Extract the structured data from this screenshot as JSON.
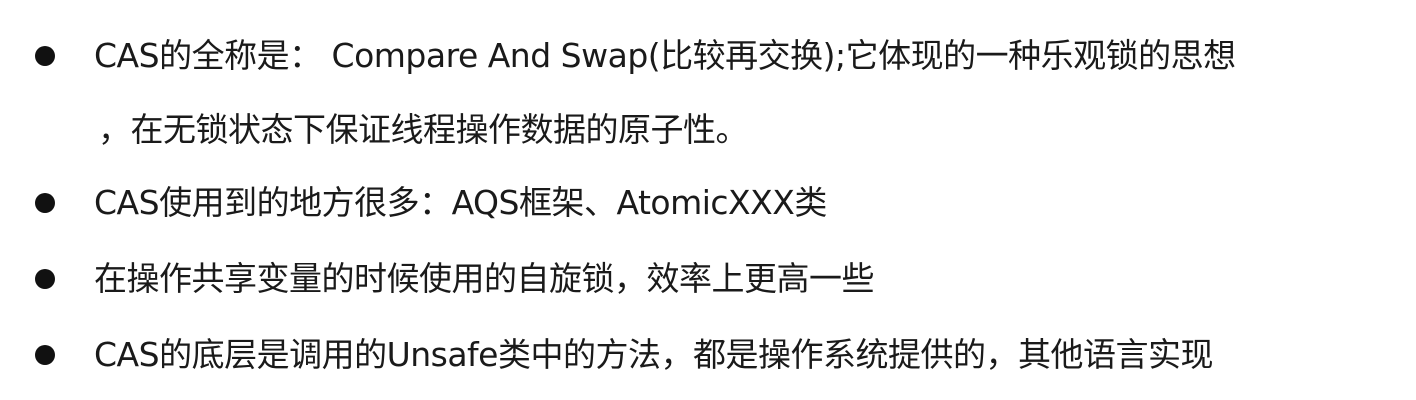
{
  "bullets": [
    {
      "lines": [
        "CAS的全称是： Compare And Swap(比较再交换);它体现的一种乐观锁的思想",
        "，在无锁状态下保证线程操作数据的原子性。"
      ]
    },
    {
      "lines": [
        "CAS使用到的地方很多：AQS框架、AtomicXXX类"
      ]
    },
    {
      "lines": [
        "在操作共享变量的时候使用的自旋锁，效率上更高一些"
      ]
    },
    {
      "lines": [
        "CAS的底层是调用的Unsafe类中的方法，都是操作系统提供的，其他语言实现"
      ]
    }
  ]
}
